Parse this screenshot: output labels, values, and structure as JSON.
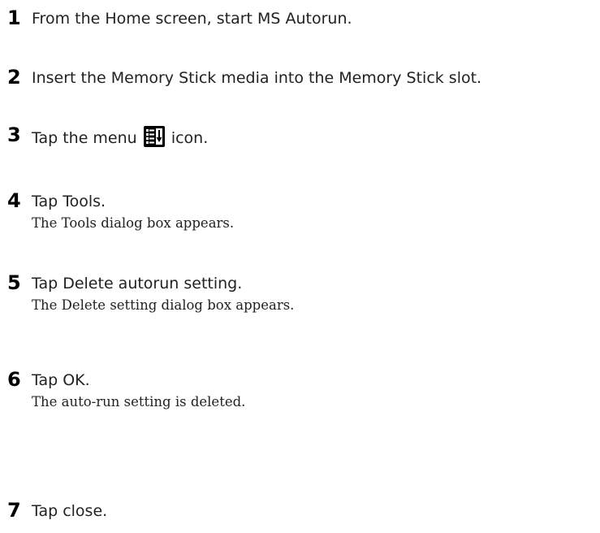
{
  "steps": [
    {
      "number": "1",
      "instruction": "From the Home screen, start MS Autorun.",
      "result": ""
    },
    {
      "number": "2",
      "instruction": "Insert the Memory Stick media into the Memory Stick slot.",
      "result": ""
    },
    {
      "number": "3",
      "instruction_before": "Tap the menu",
      "icon": "menu-icon",
      "instruction_after": "icon.",
      "result": ""
    },
    {
      "number": "4",
      "instruction": "Tap Tools.",
      "result": "The Tools dialog box appears."
    },
    {
      "number": "5",
      "instruction": "Tap Delete autorun setting.",
      "result": "The Delete setting dialog box appears."
    },
    {
      "number": "6",
      "instruction": "Tap OK.",
      "result": "The auto-run setting is deleted."
    },
    {
      "number": "7",
      "instruction": "Tap close.",
      "result": ""
    }
  ]
}
